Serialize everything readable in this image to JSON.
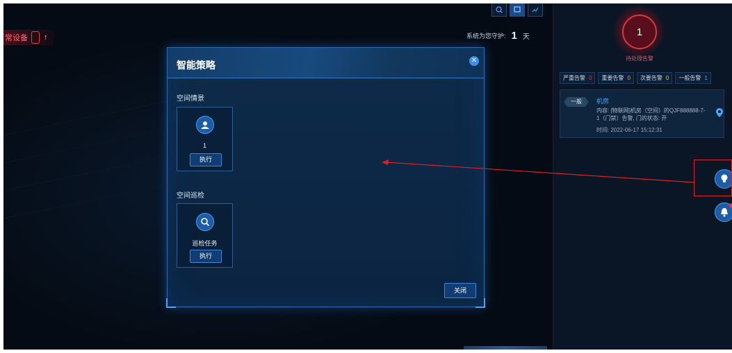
{
  "topbar": {
    "abnormal_label": "常设备",
    "abnormal_count": "",
    "up_arrow": "↑",
    "guard_text": "系统为您守护:",
    "guard_days": "1",
    "guard_unit": "天"
  },
  "dialog": {
    "title": "智能策略",
    "sections": [
      {
        "title": "空间情景",
        "card_label": "1",
        "button": "执行",
        "icon": "people-icon"
      },
      {
        "title": "空间巡检",
        "card_label": "巡检任务",
        "button": "执行",
        "icon": "search-icon"
      }
    ],
    "close_button": "关闭",
    "close_icon": "close-icon"
  },
  "alarm_panel": {
    "count": "1",
    "label": "待处理告警",
    "tabs": [
      {
        "label": "严重告警",
        "count": "0",
        "color": "#e03344"
      },
      {
        "label": "重要告警",
        "count": "0",
        "color": "#e9a13b"
      },
      {
        "label": "次要告警",
        "count": "0",
        "color": "#e9d23b"
      },
      {
        "label": "一般告警",
        "count": "1",
        "color": "#4aa6ff"
      }
    ],
    "card": {
      "level": "一般",
      "title": "机房",
      "content": "内容: [物联网]机房（空间）的QJF888888-7-1（门禁）告警, 门的状态: 开",
      "time": "时间: 2022-06-17 15:12:31"
    }
  },
  "colors": {
    "accent": "#3b86d8",
    "alarm_red": "#e03344",
    "annotation_red": "#e02020"
  }
}
